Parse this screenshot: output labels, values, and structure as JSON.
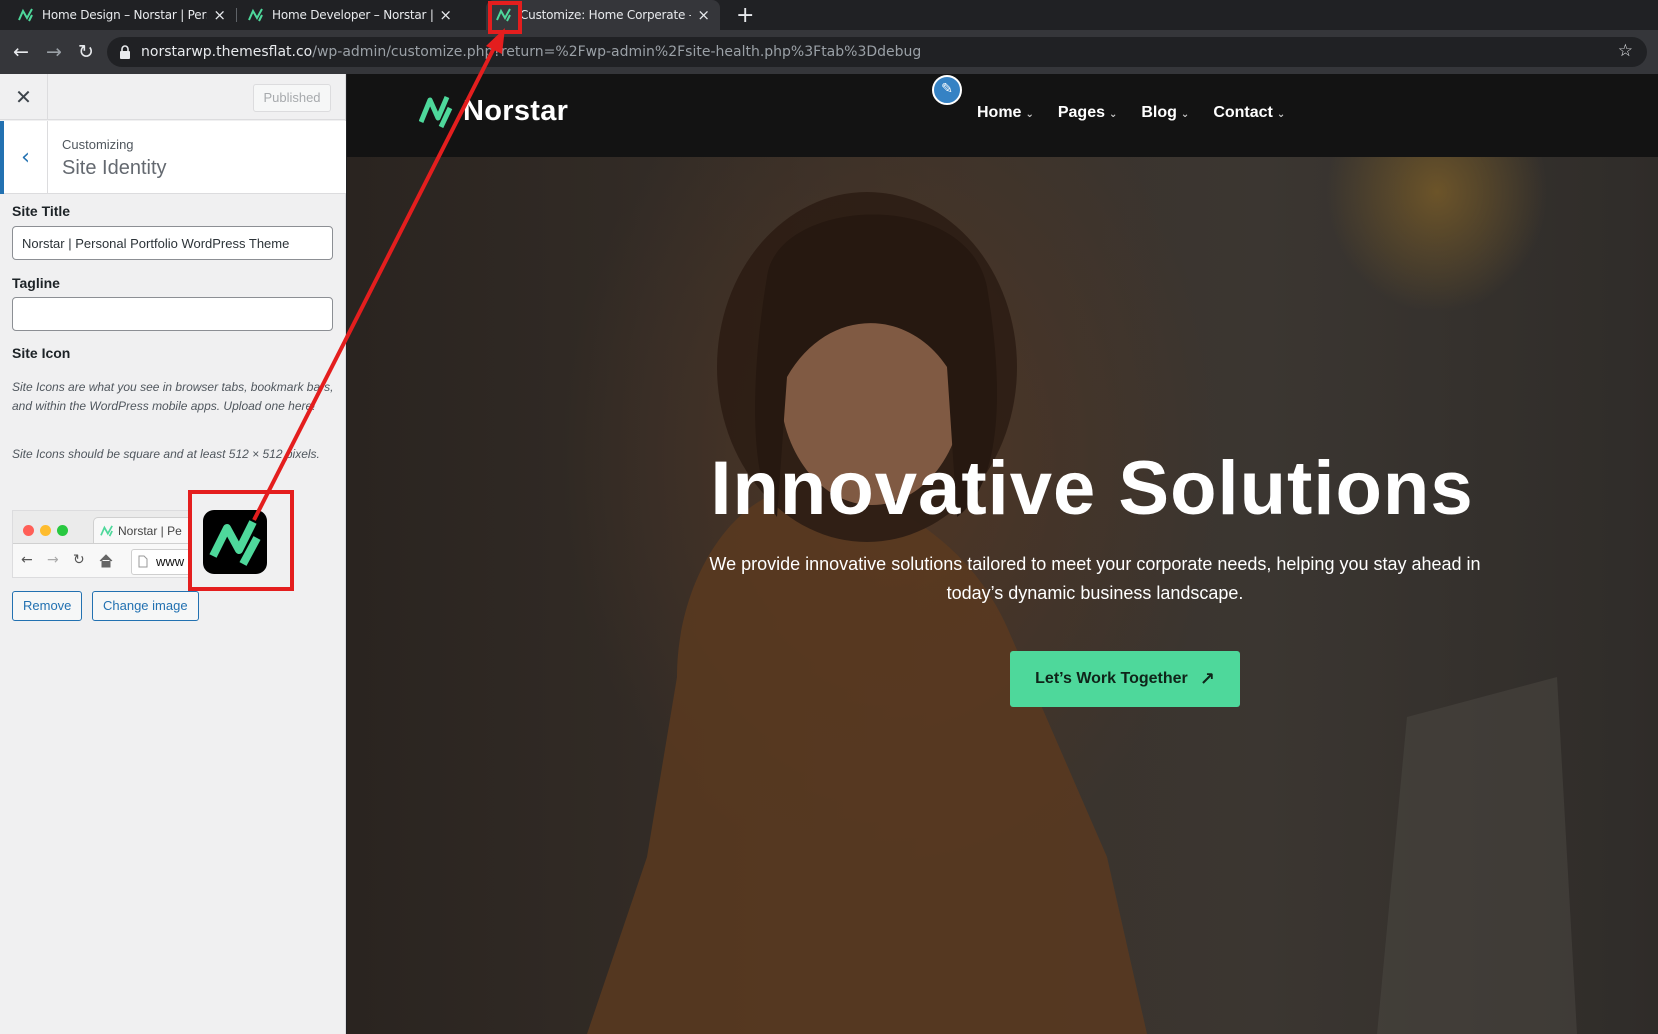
{
  "browser": {
    "tabs": [
      {
        "title": "Home Design – Norstar | Personal Portfolio WordPress Theme",
        "active": false
      },
      {
        "title": "Home Developer – Norstar | Personal Portfolio WordPress Theme",
        "active": false
      },
      {
        "title": "Customize: Home Corperate – Norstar",
        "active": true
      }
    ],
    "close_glyph": "×",
    "new_tab_glyph": "+",
    "url_host": "norstarwp.themesflat.co",
    "url_path": "/wp-admin/customize.php?return=%2Fwp-admin%2Fsite-health.php%3Ftab%3Ddebug",
    "back_glyph": "←",
    "forward_glyph": "→",
    "reload_glyph": "↻",
    "bookmark_glyph": "☆"
  },
  "customizer": {
    "close_glyph": "✕",
    "publish_label": "Published",
    "back_glyph": "‹",
    "customizing_label": "Customizing",
    "section_title": "Site Identity",
    "site_title_label": "Site Title",
    "site_title_value": "Norstar | Personal Portfolio WordPress Theme",
    "tagline_label": "Tagline",
    "tagline_value": "",
    "site_icon_label": "Site Icon",
    "site_icon_desc": "Site Icons are what you see in browser tabs, bookmark bars, and within the WordPress mobile apps. Upload one here!",
    "site_icon_size_note": "Site Icons should be square and at least 512 × 512 pixels.",
    "preview_tab_title": "Norstar | Pe",
    "preview_url": "www",
    "remove_label": "Remove",
    "change_image_label": "Change image"
  },
  "site": {
    "brand_name": "Norstar",
    "edit_glyph": "✎",
    "nav": [
      {
        "label": "Home",
        "caret": "⌄"
      },
      {
        "label": "Pages",
        "caret": "⌄"
      },
      {
        "label": "Blog",
        "caret": "⌄"
      },
      {
        "label": "Contact",
        "caret": "⌄"
      }
    ],
    "hero_title": "Innovative Solutions",
    "hero_subtitle": "We provide innovative solutions tailored to meet your corporate needs, helping you stay ahead in today’s dynamic business landscape.",
    "cta_label": "Let’s Work Together",
    "cta_arrow": "↗"
  },
  "colors": {
    "brand_green": "#4ed89b",
    "annotation_red": "#e41e1e",
    "wp_blue": "#2271b1"
  }
}
